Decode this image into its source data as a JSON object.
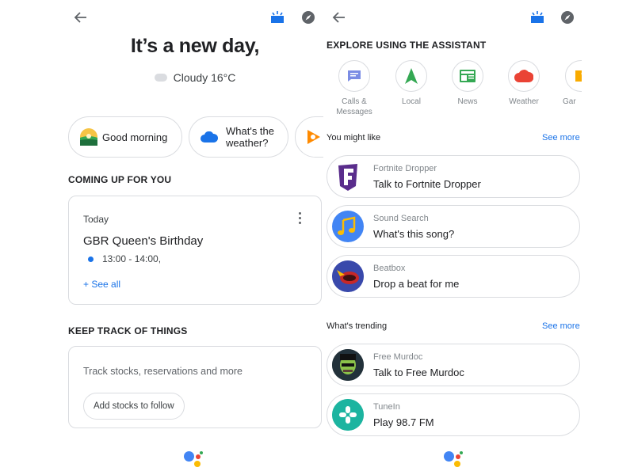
{
  "left": {
    "greeting": "It’s a new day,",
    "weather": "Cloudy 16°C",
    "chips": [
      {
        "label_line1": "Good morning",
        "label_line2": ""
      },
      {
        "label_line1": "What's the",
        "label_line2": "weather?"
      }
    ],
    "coming_up": {
      "title": "COMING UP FOR YOU",
      "day": "Today",
      "event": "GBR Queen's Birthday",
      "time": "13:00 - 14:00,",
      "see_all": "+ See all"
    },
    "keep_track": {
      "title": "KEEP TRACK OF THINGS",
      "description": "Track stocks, reservations and more",
      "button": "Add stocks to follow"
    }
  },
  "right": {
    "explore_title": "EXPLORE USING THE ASSISTANT",
    "explore_items": [
      {
        "label_line1": "Calls &",
        "label_line2": "Messages",
        "icon": "message-icon"
      },
      {
        "label_line1": "Local",
        "label_line2": "",
        "icon": "navigation-icon"
      },
      {
        "label_line1": "News",
        "label_line2": "",
        "icon": "news-icon"
      },
      {
        "label_line1": "Weather",
        "label_line2": "",
        "icon": "weather-icon"
      },
      {
        "label_line1": "Gar",
        "label_line2": "",
        "icon": "games-icon"
      }
    ],
    "you_might_like": {
      "title": "You might like",
      "see_more": "See more",
      "items": [
        {
          "source": "Fortnite Dropper",
          "title": "Talk to Fortnite Dropper",
          "icon": "fortnite-icon"
        },
        {
          "source": "Sound Search",
          "title": "What's this song?",
          "icon": "music-note-icon"
        },
        {
          "source": "Beatbox",
          "title": "Drop a beat for me",
          "icon": "beatbox-icon"
        }
      ]
    },
    "trending": {
      "title": "What's trending",
      "see_more": "See more",
      "items": [
        {
          "source": "Free Murdoc",
          "title": "Talk to Free Murdoc",
          "icon": "murdoc-avatar"
        },
        {
          "source": "TuneIn",
          "title": "Play 98.7 FM",
          "icon": "tunein-icon"
        }
      ]
    }
  },
  "colors": {
    "accent_blue": "#1a73e8",
    "google_red": "#ea4335",
    "google_yellow": "#fbbc04",
    "google_green": "#34a853",
    "border": "#dadce0",
    "muted_text": "#80868b"
  }
}
